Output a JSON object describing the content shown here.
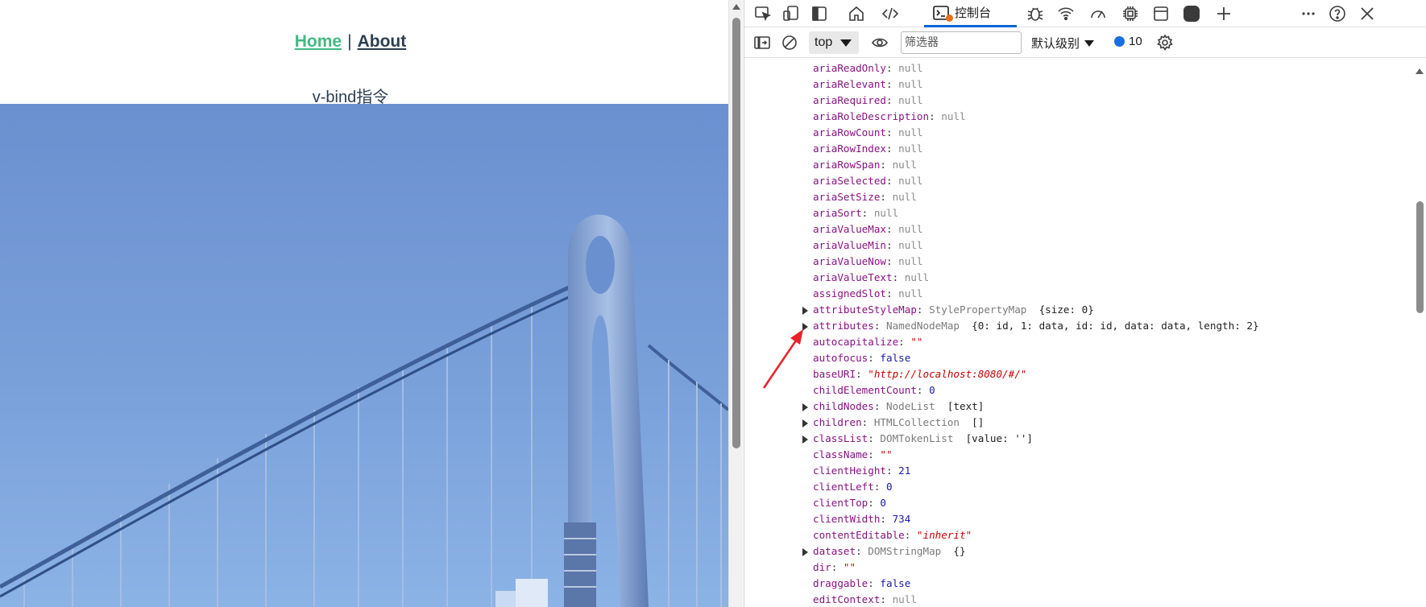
{
  "page": {
    "nav": {
      "home": "Home",
      "separator": "|",
      "about": "About"
    },
    "heading": "v-bind指令"
  },
  "devtools": {
    "tabs": {
      "console_label": "控制台",
      "icons": [
        "inspect-icon",
        "device-emulation-icon",
        "panel-toggle-icon",
        "home-icon",
        "elements-icon",
        "console-icon",
        "sources-bug-icon",
        "network-wifi-icon",
        "performance-gauge-icon",
        "memory-chip-icon",
        "application-icon",
        "record-icon",
        "add-tab-icon",
        "more-icon",
        "help-icon",
        "close-icon"
      ]
    },
    "toolbar": {
      "context": "top",
      "filter_placeholder": "筛选器",
      "level": "默认级别",
      "message_count": "10"
    },
    "properties": [
      {
        "key": "ariaReadOnly",
        "value": "null",
        "kind": "null"
      },
      {
        "key": "ariaRelevant",
        "value": "null",
        "kind": "null"
      },
      {
        "key": "ariaRequired",
        "value": "null",
        "kind": "null"
      },
      {
        "key": "ariaRoleDescription",
        "value": "null",
        "kind": "null"
      },
      {
        "key": "ariaRowCount",
        "value": "null",
        "kind": "null"
      },
      {
        "key": "ariaRowIndex",
        "value": "null",
        "kind": "null"
      },
      {
        "key": "ariaRowSpan",
        "value": "null",
        "kind": "null"
      },
      {
        "key": "ariaSelected",
        "value": "null",
        "kind": "null"
      },
      {
        "key": "ariaSetSize",
        "value": "null",
        "kind": "null"
      },
      {
        "key": "ariaSort",
        "value": "null",
        "kind": "null"
      },
      {
        "key": "ariaValueMax",
        "value": "null",
        "kind": "null"
      },
      {
        "key": "ariaValueMin",
        "value": "null",
        "kind": "null"
      },
      {
        "key": "ariaValueNow",
        "value": "null",
        "kind": "null"
      },
      {
        "key": "ariaValueText",
        "value": "null",
        "kind": "null"
      },
      {
        "key": "assignedSlot",
        "value": "null",
        "kind": "null"
      },
      {
        "key": "attributeStyleMap",
        "type": "StylePropertyMap",
        "preview": "{size: 0}",
        "expandable": true
      },
      {
        "key": "attributes",
        "type": "NamedNodeMap",
        "preview": "{0: id, 1: data, id: id, data: data, length: 2}",
        "expandable": true
      },
      {
        "key": "autocapitalize",
        "value": "\"\"",
        "kind": "str"
      },
      {
        "key": "autofocus",
        "value": "false",
        "kind": "bool"
      },
      {
        "key": "baseURI",
        "value": "\"http://localhost:8080/#/\"",
        "kind": "str"
      },
      {
        "key": "childElementCount",
        "value": "0",
        "kind": "num"
      },
      {
        "key": "childNodes",
        "type": "NodeList",
        "preview": "[text]",
        "expandable": true
      },
      {
        "key": "children",
        "type": "HTMLCollection",
        "preview": "[]",
        "expandable": true
      },
      {
        "key": "classList",
        "type": "DOMTokenList",
        "preview": "[value: '']",
        "expandable": true
      },
      {
        "key": "className",
        "value": "\"\"",
        "kind": "str"
      },
      {
        "key": "clientHeight",
        "value": "21",
        "kind": "num"
      },
      {
        "key": "clientLeft",
        "value": "0",
        "kind": "num"
      },
      {
        "key": "clientTop",
        "value": "0",
        "kind": "num"
      },
      {
        "key": "clientWidth",
        "value": "734",
        "kind": "num"
      },
      {
        "key": "contentEditable",
        "value": "\"inherit\"",
        "kind": "str"
      },
      {
        "key": "dataset",
        "type": "DOMStringMap",
        "preview": "{}",
        "expandable": true
      },
      {
        "key": "dir",
        "value": "\"\"",
        "kind": "str"
      },
      {
        "key": "draggable",
        "value": "false",
        "kind": "bool"
      },
      {
        "key": "editContext",
        "value": "null",
        "kind": "null"
      }
    ]
  }
}
